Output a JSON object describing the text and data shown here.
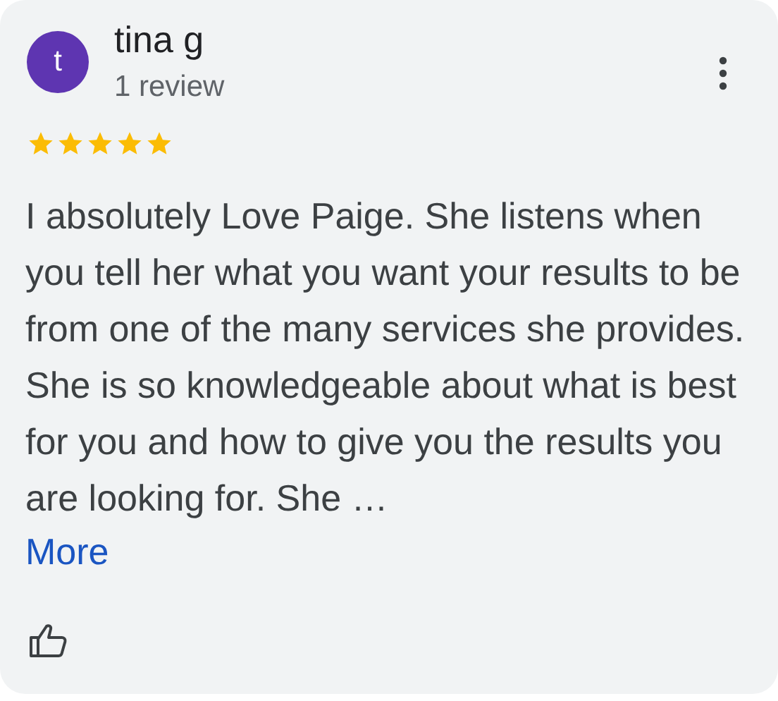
{
  "review": {
    "avatar_letter": "t",
    "author": "tina g",
    "author_meta": "1 review",
    "stars": 5,
    "text": "I absolutely Love Paige. She listens when you tell her what you want your results to be from one of the many services she provides. She is so knowledgeable about what is best for you and how to give you the results you are looking for. She …",
    "more_link": "More"
  }
}
